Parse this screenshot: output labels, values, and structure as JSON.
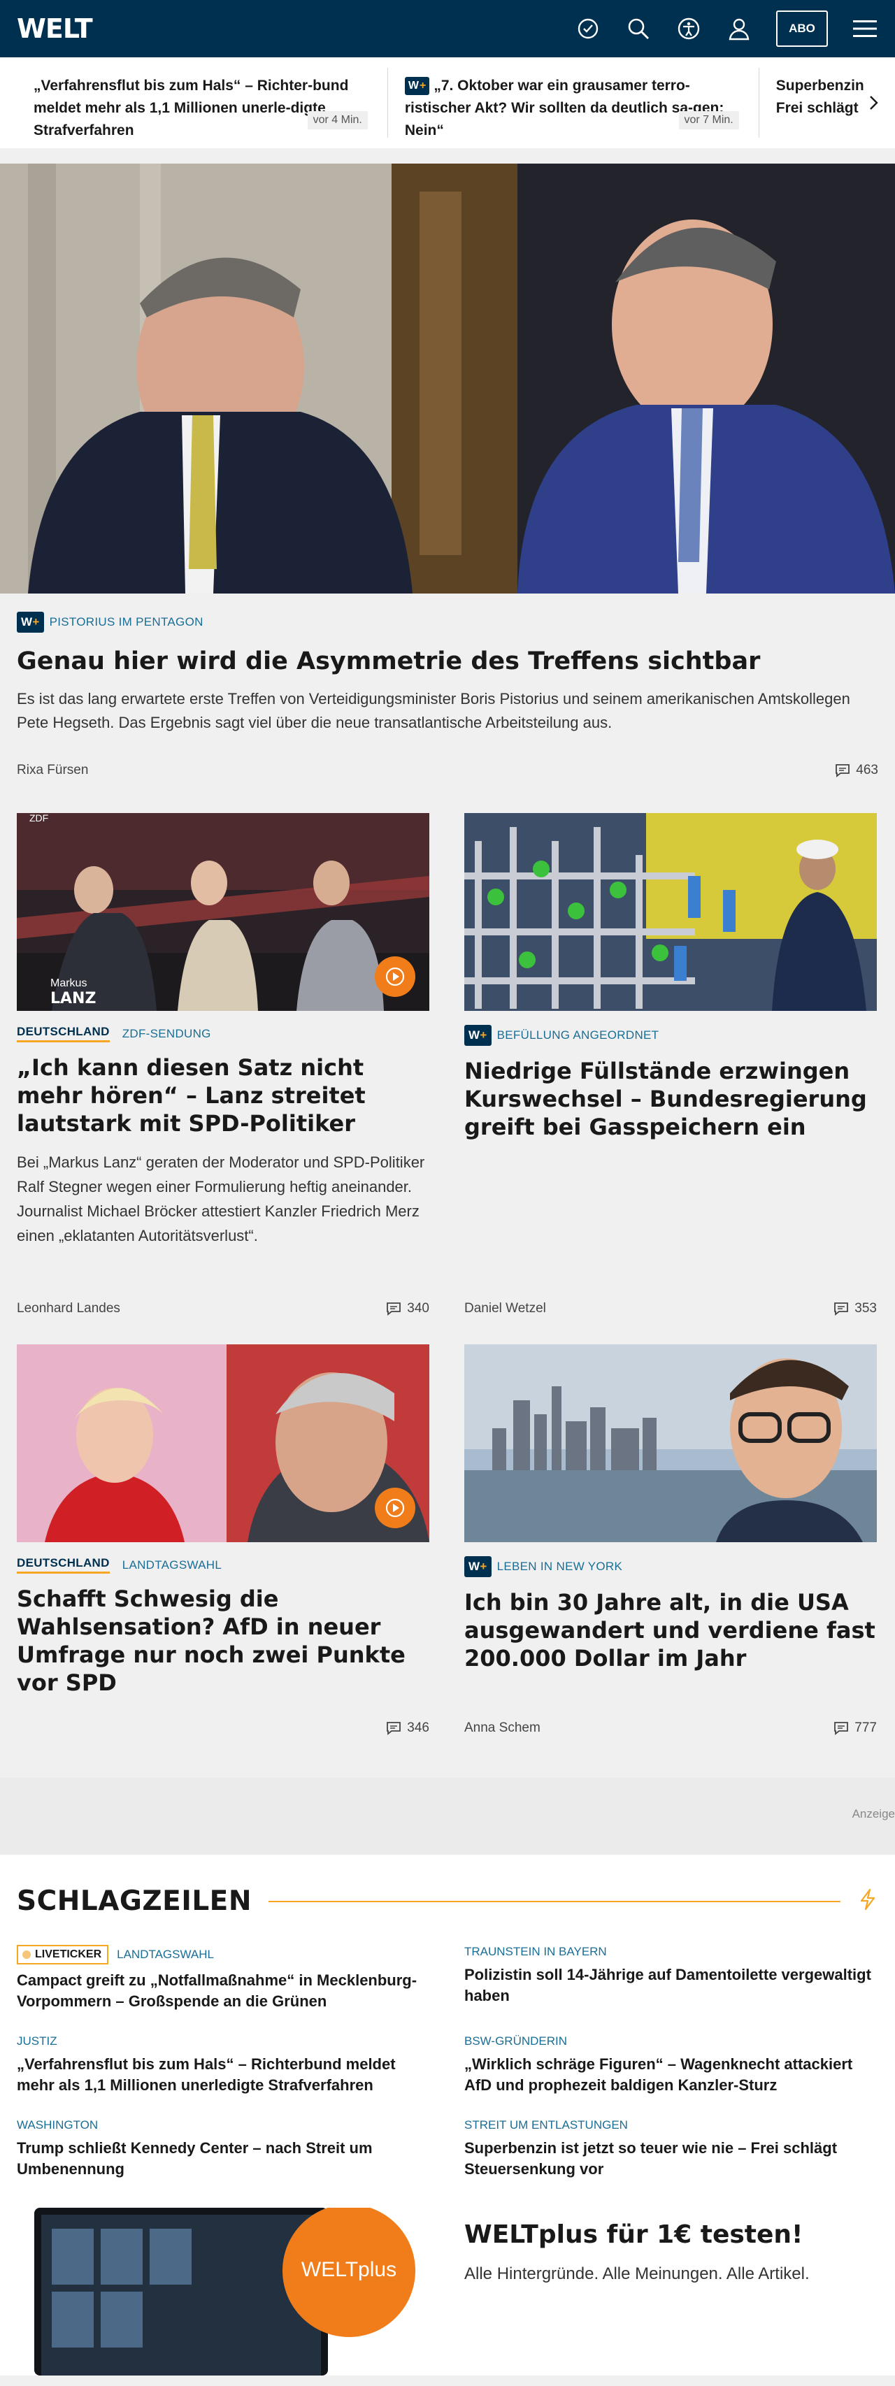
{
  "header": {
    "logo": "WELT",
    "abo_label": "ABO",
    "icons": [
      "history-icon",
      "search-icon",
      "accessibility-icon",
      "account-icon",
      "menu-icon"
    ]
  },
  "ticker": {
    "items": [
      {
        "text": "„Verfahrensflut bis zum Hals“ – Richter-bund meldet mehr als 1,1 Millionen unerle-digte Strafverfahren",
        "time": "vor 4 Min.",
        "premium": false
      },
      {
        "text": "„7. Oktober war ein grausamer terro-ristischer Akt? Wir sollten da deutlich sa-gen: Nein“",
        "time": "vor 7 Min.",
        "premium": true
      },
      {
        "text": "Superbenzin Frei schlägt",
        "time": "",
        "premium": false
      }
    ]
  },
  "hero": {
    "premium_badge": "W+",
    "kicker": "PISTORIUS IM PENTAGON",
    "title": "Genau hier wird die Asymmetrie des Treffens sichtbar",
    "text": "Es ist das lang erwartete erste Treffen von Verteidigungsminister Boris Pistorius und seinem amerikanischen Amtskollegen Pete Hegseth. Das Ergebnis sagt viel über die neue transatlantische Arbeitsteilung aus.",
    "author": "Rixa Fürsen",
    "comments": "463"
  },
  "tiles": [
    {
      "dept": "DEUTSCHLAND",
      "kicker": "ZDF-SENDUNG",
      "title": "„Ich kann diesen Satz nicht mehr hören“ – Lanz streitet lautstark mit SPD-Politiker",
      "text": "Bei „Markus Lanz“ geraten der Moderator und SPD-Politiker Ralf Stegner wegen einer Formulierung heftig aneinander. Journalist Michael Bröcker attestiert Kanzler Friedrich Merz einen „eklatanten Autoritätsverlust“.",
      "author": "Leonhard Landes",
      "comments": "340",
      "img_caption_top": "ZDF",
      "img_caption_name": "Markus",
      "img_caption_show": "LANZ"
    },
    {
      "badge": "W+",
      "kicker": "BEFÜLLUNG ANGEORDNET",
      "title": "Niedrige Füllstände erzwingen Kurswechsel – Bundesregierung greift bei Gasspeichern ein",
      "author": "Daniel Wetzel",
      "comments": "353"
    },
    {
      "dept": "DEUTSCHLAND",
      "kicker": "LANDTAGSWAHL",
      "title": "Schafft Schwesig die Wahlsensation? AfD in neuer Umfrage nur noch zwei Punkte vor SPD",
      "comments": "346"
    },
    {
      "badge": "W+",
      "kicker": "LEBEN IN NEW YORK",
      "title": "Ich bin 30 Jahre alt, in die USA ausgewandert und verdiene fast 200.000 Dollar im Jahr",
      "author": "Anna Schem",
      "comments": "777"
    }
  ],
  "ad": {
    "label": "Anzeige"
  },
  "headlines": {
    "title": "SCHLAGZEILEN",
    "items": [
      {
        "live": "LIVETICKER",
        "kicker": "LANDTAGSWAHL",
        "title": "Campact greift zu „Notfallmaßnahme“ in Mecklenburg-Vorpommern – Großspende an die Grünen"
      },
      {
        "kicker": "TRAUNSTEIN IN BAYERN",
        "title": "Polizistin soll 14-Jährige auf Damentoilette vergewaltigt haben"
      },
      {
        "kicker": "JUSTIZ",
        "title": "„Verfahrensflut bis zum Hals“ – Richterbund meldet mehr als 1,1 Millionen unerledigte Strafverfahren"
      },
      {
        "kicker": "BSW-GRÜNDERIN",
        "title": "„Wirklich schräge Figuren“ – Wagenknecht attackiert AfD und prophezeit baldigen Kanzler-Sturz"
      },
      {
        "kicker": "WASHINGTON",
        "title": "Trump schließt Kennedy Center – nach Streit um Umbenennung"
      },
      {
        "kicker": "STREIT UM ENTLASTUNGEN",
        "title": "Superbenzin ist jetzt so teuer wie nie – Frei schlägt Steuersenkung vor"
      }
    ]
  },
  "promo": {
    "title": "WELTplus für 1€ testen!",
    "subtitle": "Alle Hintergründe. Alle Meinungen. Alle Artikel.",
    "badge": "WELTplus"
  },
  "colors": {
    "brand_navy": "#00304f",
    "accent_orange": "#f5a623",
    "kicker_blue": "#1a6e96",
    "play_orange": "#f07d1a"
  }
}
